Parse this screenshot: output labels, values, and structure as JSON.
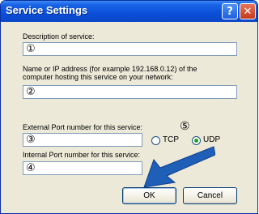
{
  "window": {
    "title": "Service Settings"
  },
  "titlebar": {
    "help_glyph": "?",
    "close_glyph": "✕"
  },
  "description": {
    "label": "Description of service:",
    "value": "①"
  },
  "address": {
    "label_line1": "Name or IP address (for example 192.168.0.12) of the",
    "label_line2": "computer hosting this service on your network:",
    "value": "②"
  },
  "external_port": {
    "label": "External Port number for this service:",
    "value": "③"
  },
  "protocol": {
    "callout": "⑤",
    "options": [
      {
        "label": "TCP",
        "selected": false
      },
      {
        "label": "UDP",
        "selected": true
      }
    ]
  },
  "internal_port": {
    "label": "Internal Port number for this service:",
    "value": "④"
  },
  "buttons": {
    "ok": "OK",
    "cancel": "Cancel"
  },
  "colors": {
    "title_bar": "#0a4fd8",
    "dialog_bg": "#ece9d8",
    "arrow": "#1f5fb8"
  }
}
